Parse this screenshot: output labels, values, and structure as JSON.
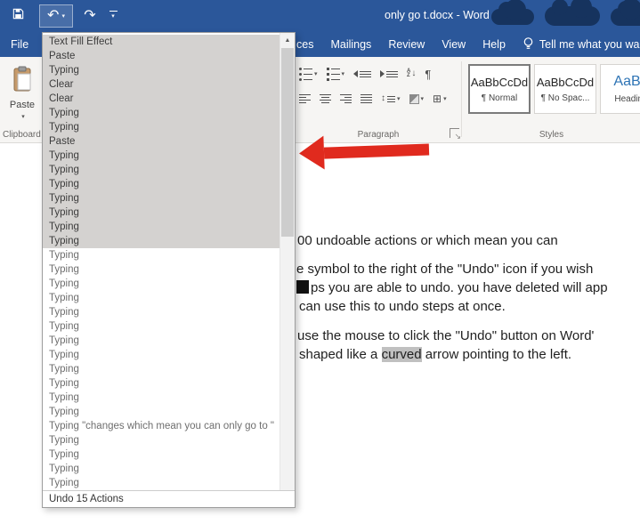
{
  "titlebar": {
    "title": "only go t.docx - Word"
  },
  "tabs": {
    "file": "File",
    "references_partial": "ces",
    "mailings": "Mailings",
    "review": "Review",
    "view": "View",
    "help": "Help",
    "tell_me": "Tell me what you wa"
  },
  "ribbon": {
    "paste_label": "Paste",
    "group_clipboard": "Clipboard",
    "group_paragraph": "Paragraph",
    "group_styles": "Styles",
    "styles_gallery": [
      {
        "sample": "AaBbCcDd",
        "name": "¶ Normal",
        "selected": true
      },
      {
        "sample": "AaBbCcDd",
        "name": "¶ No Spac...",
        "selected": false
      },
      {
        "sample": "AaBb",
        "name": "Heading",
        "selected": false,
        "kind": "heading"
      }
    ]
  },
  "undo_menu": {
    "items": [
      {
        "label": "Text Fill Effect",
        "selected": true
      },
      {
        "label": "Paste",
        "selected": true
      },
      {
        "label": "Typing",
        "selected": true
      },
      {
        "label": "Clear",
        "selected": true
      },
      {
        "label": "Clear",
        "selected": true
      },
      {
        "label": "Typing",
        "selected": true
      },
      {
        "label": "Typing",
        "selected": true
      },
      {
        "label": "Paste",
        "selected": true
      },
      {
        "label": "Typing",
        "selected": true
      },
      {
        "label": "Typing",
        "selected": true
      },
      {
        "label": "Typing",
        "selected": true
      },
      {
        "label": "Typing",
        "selected": true
      },
      {
        "label": "Typing",
        "selected": true
      },
      {
        "label": "Typing",
        "selected": true
      },
      {
        "label": "Typing",
        "selected": true
      },
      {
        "label": "Typing",
        "selected": false
      },
      {
        "label": "Typing",
        "selected": false
      },
      {
        "label": "Typing",
        "selected": false
      },
      {
        "label": "Typing",
        "selected": false
      },
      {
        "label": "Typing",
        "selected": false
      },
      {
        "label": "Typing",
        "selected": false
      },
      {
        "label": "Typing",
        "selected": false
      },
      {
        "label": "Typing",
        "selected": false
      },
      {
        "label": "Typing",
        "selected": false
      },
      {
        "label": "Typing",
        "selected": false
      },
      {
        "label": "Typing",
        "selected": false
      },
      {
        "label": "Typing",
        "selected": false
      },
      {
        "label": "Typing \"changes which mean you can only go to \"",
        "selected": false
      },
      {
        "label": "Typing",
        "selected": false
      },
      {
        "label": "Typing",
        "selected": false
      },
      {
        "label": "Typing",
        "selected": false
      },
      {
        "label": "Typing",
        "selected": false
      }
    ],
    "status": "Undo 15 Actions"
  },
  "document": {
    "line1": "00 undoable actions or which mean you can",
    "line2": "e symbol to the right of the \"Undo\" icon if you wish",
    "line3": "ps you are able to undo. you have deleted will app",
    "line4": "can use this to undo steps at once.",
    "line5": "use the mouse to click the \"Undo\" button on Word'",
    "line6": {
      "pre": "shaped like a ",
      "highlighted": "curved",
      "post": " arrow pointing to the left."
    }
  },
  "icons": {
    "undo": "↶",
    "redo": "↷",
    "dropdown": "▾",
    "scroll_up": "▲",
    "scroll_down": "▼",
    "pilcrow": "¶",
    "borders": "⊞",
    "line_spacing": "↕",
    "sort_arrow": "↓",
    "sort_a": "A",
    "sort_z": "Z",
    "launcher": "↘"
  },
  "colors": {
    "titlebar_blue": "#2b579a",
    "annotation_arrow_red": "#e02a1e",
    "undo_selection_gray": "#d4d2d0",
    "text_highlight_gray": "#c0c0c0",
    "heading_style_blue": "#2e74b5"
  }
}
